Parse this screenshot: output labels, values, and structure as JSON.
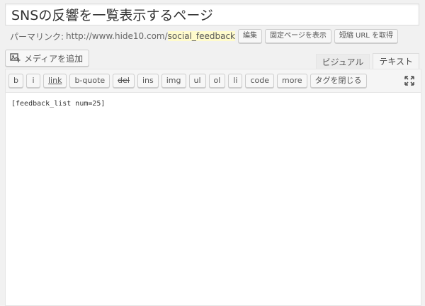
{
  "title": {
    "value": "SNSの反響を一覧表示するページ"
  },
  "permalink": {
    "label": "パーマリンク:",
    "base_url": "http://www.hide10.com/",
    "slug": "social_feedback",
    "buttons": [
      "編集",
      "固定ページを表示",
      "短縮 URL を取得"
    ]
  },
  "media_button": {
    "label": "メディアを追加",
    "icon": "media-icon"
  },
  "tabs": {
    "visual": "ビジュアル",
    "text": "テキスト"
  },
  "quicktags": [
    "b",
    "i",
    "link",
    "b-quote",
    "del",
    "ins",
    "img",
    "ul",
    "ol",
    "li",
    "code",
    "more",
    "タグを閉じる"
  ],
  "editor": {
    "content": "[feedback_list num=25]",
    "fullscreen_icon": "expand-icon"
  }
}
